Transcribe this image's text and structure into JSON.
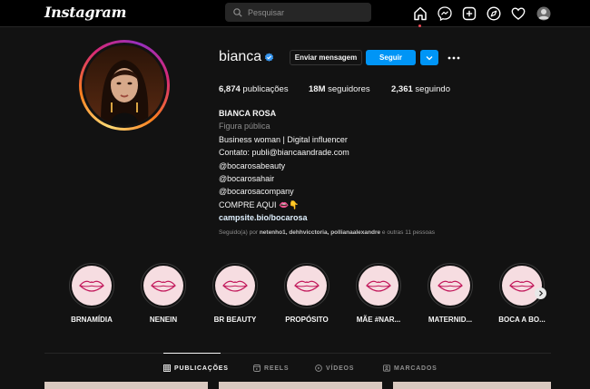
{
  "nav": {
    "logo": "Instagram",
    "search_placeholder": "Pesquisar",
    "icons": [
      "home-icon",
      "messenger-icon",
      "new-post-icon",
      "explore-icon",
      "activity-heart-icon",
      "profile-avatar"
    ]
  },
  "profile": {
    "username": "bianca",
    "verified": true,
    "buttons": {
      "message": "Enviar mensagem",
      "follow": "Seguir",
      "dropdown": "chevron-down-icon",
      "more": "more-options-icon"
    },
    "stats": {
      "posts_value": "6,874",
      "posts_label": "publicações",
      "followers_value": "18M",
      "followers_label": "seguidores",
      "following_value": "2,361",
      "following_label": "seguindo"
    },
    "bio": {
      "name": "BIANCA ROSA",
      "category": "Figura pública",
      "lines": [
        "Business woman | Digital influencer",
        "Contato: publi@biancaandrade.com",
        "@bocarosabeauty",
        "@bocarosahair",
        "@bocarosacompany",
        "COMPRE AQUI 👄👇"
      ],
      "link": "campsite.bio/bocarosa"
    },
    "followed_by": {
      "prefix": "Seguido(a) por",
      "names": "netenho1, dehhvicctoria, pollianaalexandre",
      "suffix": "e outras 11 pessoas"
    }
  },
  "highlights": [
    {
      "label": "BRNAMÍDIA"
    },
    {
      "label": "NENEIN"
    },
    {
      "label": "BR BEAUTY"
    },
    {
      "label": "PROPÓSITO"
    },
    {
      "label": "MÃE #NAR..."
    },
    {
      "label": "MATERNID..."
    },
    {
      "label": "BOCA A BO..."
    }
  ],
  "tabs": [
    {
      "label": "PUBLICAÇÕES",
      "icon": "grid-icon",
      "active": true
    },
    {
      "label": "REELS",
      "icon": "reels-icon",
      "active": false
    },
    {
      "label": "VÍDEOS",
      "icon": "video-icon",
      "active": false
    },
    {
      "label": "MARCADOS",
      "icon": "tagged-icon",
      "active": false
    }
  ],
  "colors": {
    "background": "#121212",
    "accent": "#0095f6",
    "highlight_fill": "#f6dde1",
    "lips": "#c2185b"
  }
}
